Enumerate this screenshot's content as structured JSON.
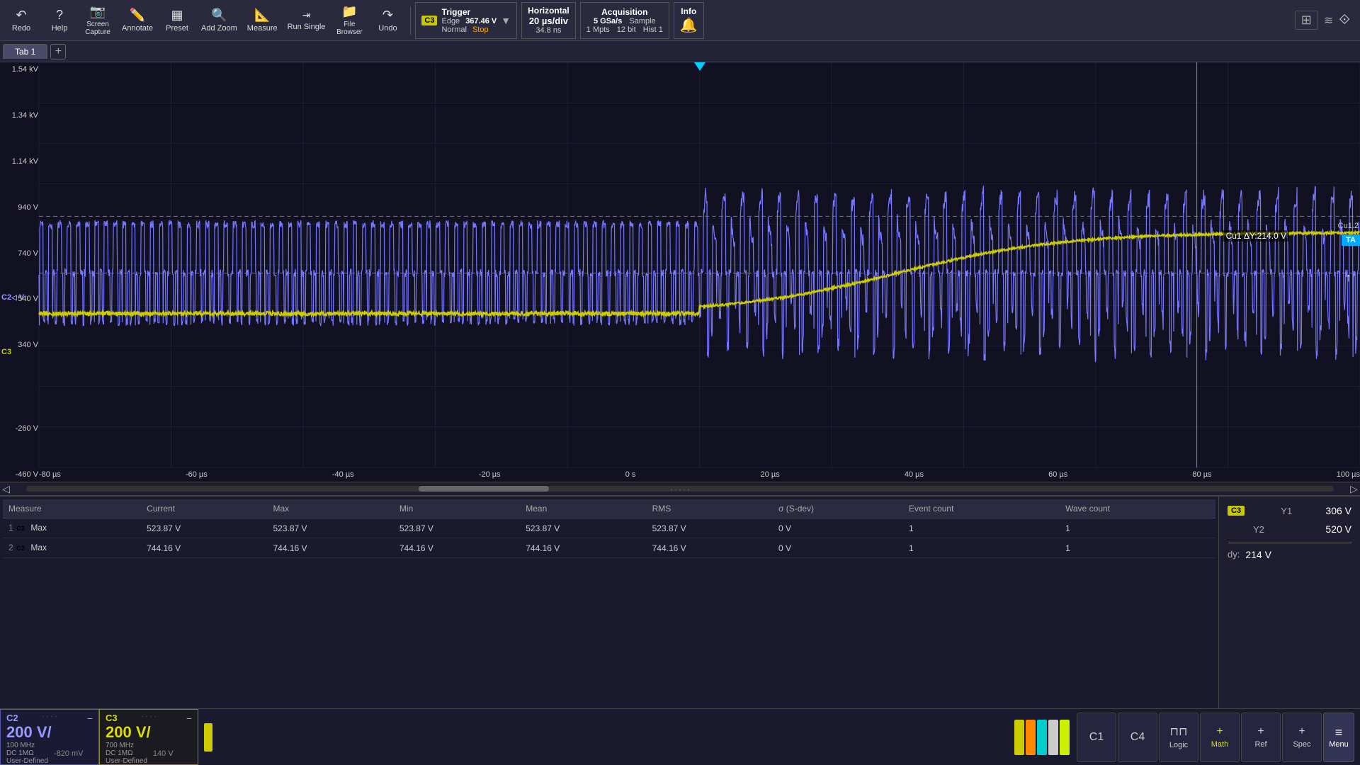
{
  "toolbar": {
    "redo_label": "Redo",
    "help_label": "Help",
    "screen_capture_label": "Screen\nCapture",
    "annotate_label": "Annotate",
    "preset_label": "Preset",
    "add_zoom_label": "Add Zoom",
    "measure_label": "Measure",
    "run_single_label": "Run Single",
    "file_browser_label": "File\nBrowser",
    "undo_label": "Undo"
  },
  "trigger": {
    "title": "Trigger",
    "type": "Edge",
    "value": "367.46 V",
    "mode": "Normal",
    "action": "Stop"
  },
  "horizontal": {
    "title": "Horizontal",
    "time_div": "20 µs/div",
    "sample_delay": "34.8 ns"
  },
  "acquisition": {
    "title": "Acquisition",
    "rate": "5 GSa/s",
    "memory": "1 Mpts",
    "mode": "Sample",
    "bit_depth": "12 bit",
    "hist": "Hist 1"
  },
  "info": {
    "title": "Info"
  },
  "tab": {
    "name": "Tab 1"
  },
  "waveform": {
    "y_labels": [
      "1.54 kV",
      "1.34 kV",
      "1.14 kV",
      "940 V",
      "740 V",
      "540 V",
      "340 V",
      "",
      "-260 V",
      "-460 V"
    ],
    "x_labels": [
      "-80 µs",
      "-60 µs",
      "-40 µs",
      "-20 µs",
      "0 s",
      "20 µs",
      "40 µs",
      "60 µs",
      "80 µs",
      "100 µs"
    ],
    "c2_label": "C2",
    "c3_label": "C3",
    "cursor_annotation": "Cu1 ΔY:214.0 V",
    "cu1_2_label": "Cu1.2"
  },
  "measurement": {
    "columns": [
      "Measure",
      "Current",
      "Max",
      "Min",
      "Mean",
      "RMS",
      "σ (S-dev)",
      "Event count",
      "Wave count"
    ],
    "rows": [
      {
        "num": "1",
        "channel": "C3",
        "channel_class": "c3",
        "type": "Max",
        "current": "523.87 V",
        "max": "523.87 V",
        "min": "523.87 V",
        "mean": "523.87 V",
        "rms": "523.87 V",
        "sdev": "0 V",
        "event_count": "1",
        "wave_count": "1"
      },
      {
        "num": "2",
        "channel": "C2",
        "channel_class": "c2",
        "type": "Max",
        "current": "744.16 V",
        "max": "744.16 V",
        "min": "744.16 V",
        "mean": "744.16 V",
        "rms": "744.16 V",
        "sdev": "0 V",
        "event_count": "1",
        "wave_count": "1"
      }
    ]
  },
  "cursor_panel": {
    "channel": "C3",
    "y1_label": "Y1",
    "y1_value": "306 V",
    "y2_label": "Y2",
    "y2_value": "520 V",
    "dy_label": "dy:",
    "dy_value": "214 V"
  },
  "channels": {
    "c2": {
      "name": "C2",
      "volts": "200 V/",
      "offset": "-820 mV",
      "freq": "100 MHz",
      "coupling": "DC 1MΩ",
      "probe": "User-Defined"
    },
    "c3": {
      "name": "C3",
      "volts": "200 V/",
      "offset": "140 V",
      "freq": "700 MHz",
      "coupling": "DC 1MΩ",
      "probe": "User-Defined"
    }
  },
  "bottom_buttons": {
    "c1_label": "C1",
    "c4_label": "C4",
    "logic_label": "Logic",
    "math_label": "Math",
    "ref_label": "Ref",
    "spec_label": "Spec",
    "menu_label": "Menu"
  },
  "colors": {
    "c2": "#7777ff",
    "c3": "#cccc00",
    "yellow_green": "#ccee00",
    "cyan": "#00ccff",
    "accent": "#4466ff"
  }
}
